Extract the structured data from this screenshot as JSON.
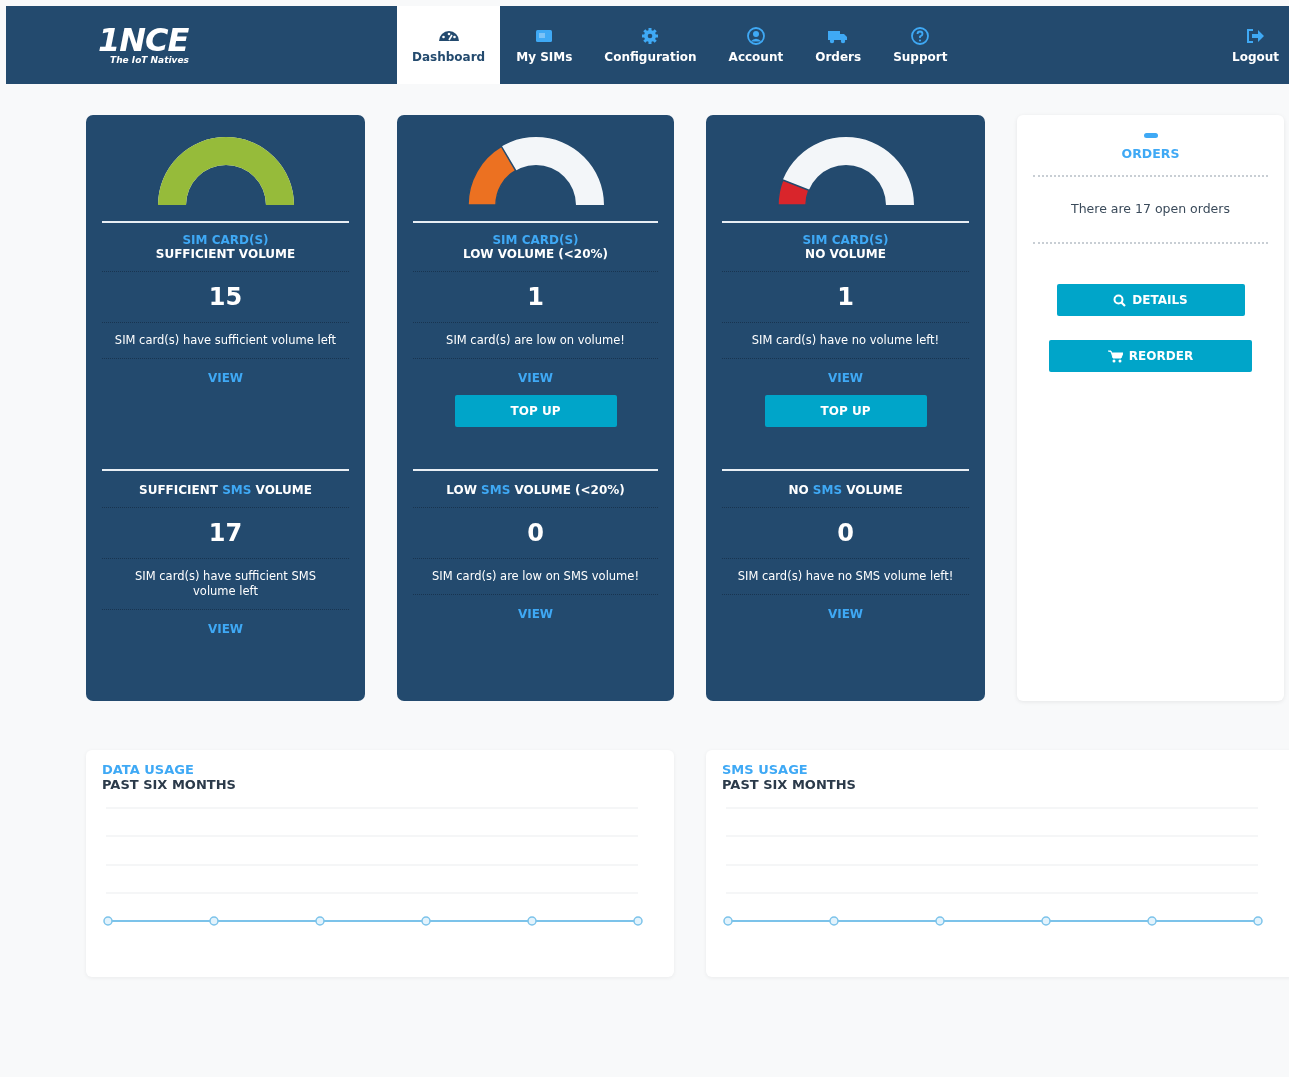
{
  "nav": {
    "logo": {
      "wordmark": "1NCE",
      "tagline": "The IoT Natives"
    },
    "tabs": [
      {
        "kind": "dashboard",
        "label": "Dashboard",
        "selected": true
      },
      {
        "kind": "sims",
        "label": "My SIMs",
        "selected": false
      },
      {
        "kind": "config",
        "label": "Configuration",
        "selected": false
      },
      {
        "kind": "account",
        "label": "Account",
        "selected": false
      },
      {
        "kind": "orders",
        "label": "Orders",
        "selected": false
      },
      {
        "kind": "support",
        "label": "Support",
        "selected": false
      }
    ],
    "logout": {
      "label": "Logout"
    }
  },
  "cards": [
    {
      "gauge": {
        "kind": "full",
        "color": "#96bb3a"
      },
      "data": {
        "label": "SIM CARD(S)",
        "title": "SUFFICIENT VOLUME",
        "count": "15",
        "description": "SIM card(s) have sufficient volume left",
        "link": "VIEW"
      },
      "sms": {
        "title_before": "SUFFICIENT ",
        "highlight": "SMS",
        "title_after": " VOLUME",
        "count": "17",
        "description": "SIM card(s) have sufficient SMS volume left",
        "link": "VIEW"
      }
    },
    {
      "gauge": {
        "kind": "low",
        "color": "#ec7121"
      },
      "data": {
        "label": "SIM CARD(S)",
        "title": "LOW VOLUME (<20%)",
        "count": "1",
        "description": "SIM card(s) are low on volume!",
        "link": "VIEW",
        "button": "TOP UP"
      },
      "sms": {
        "title_before": "LOW ",
        "highlight": "SMS",
        "title_after": " VOLUME (<20%)",
        "count": "0",
        "description": "SIM card(s) are low on SMS volume!",
        "link": "VIEW"
      }
    },
    {
      "gauge": {
        "kind": "empty",
        "color": "#d9252b"
      },
      "data": {
        "label": "SIM CARD(S)",
        "title": "NO VOLUME",
        "count": "1",
        "description": "SIM card(s) have no volume left!",
        "link": "VIEW",
        "button": "TOP UP"
      },
      "sms": {
        "title_before": "NO ",
        "highlight": "SMS",
        "title_after": " VOLUME",
        "count": "0",
        "description": "SIM card(s) have no SMS volume left!",
        "link": "VIEW"
      }
    }
  ],
  "orders": {
    "title": "ORDERS",
    "text": "There are 17 open orders",
    "buttons": [
      {
        "kind": "details",
        "label": "DETAILS"
      },
      {
        "kind": "reorder",
        "label": "REORDER"
      }
    ]
  },
  "charts": [
    {
      "label": "DATA USAGE",
      "subtitle": "PAST SIX MONTHS"
    },
    {
      "label": "SMS USAGE",
      "subtitle": "PAST SIX MONTHS"
    }
  ]
}
